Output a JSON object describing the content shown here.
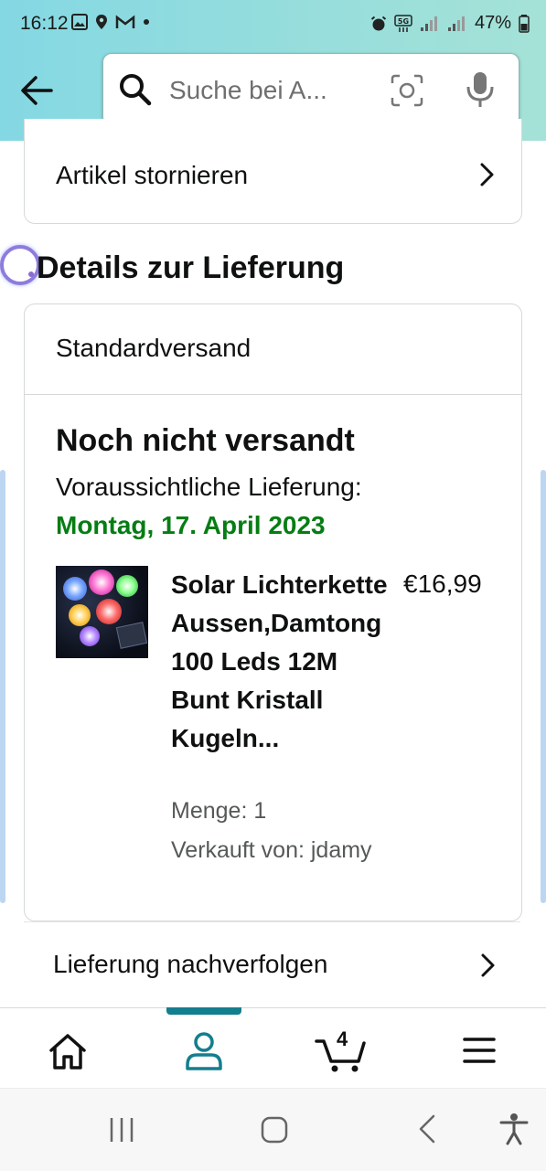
{
  "status_bar": {
    "time": "16:12",
    "battery": "47%",
    "network": "5G"
  },
  "search": {
    "placeholder": "Suche bei A..."
  },
  "cancel": {
    "label": "Artikel stornieren"
  },
  "delivery": {
    "section_title": "Details zur Lieferung",
    "shipping_method": "Standardversand",
    "status": "Noch nicht versandt",
    "eta_label": "Voraussichtliche Lieferung:",
    "eta_date": "Montag, 17. April 2023",
    "product": {
      "title": "Solar Lichterkette Aussen,Damtong 100 Leds 12M Bunt Kristall Kugeln...",
      "price": "€16,99",
      "quantity": "Menge: 1",
      "seller": "Verkauft von: jdamy"
    }
  },
  "tracking": {
    "label": "Lieferung nachverfolgen"
  },
  "bottom_nav": {
    "items": [
      "home-icon",
      "account-icon",
      "cart-icon",
      "menu-icon"
    ],
    "active": "account-icon",
    "cart_count": "4"
  },
  "colors": {
    "header_gradient_start": "#84d8e3",
    "header_gradient_end": "#a5e2d7",
    "eta_green": "#067d14",
    "nav_active": "#137e8e"
  }
}
